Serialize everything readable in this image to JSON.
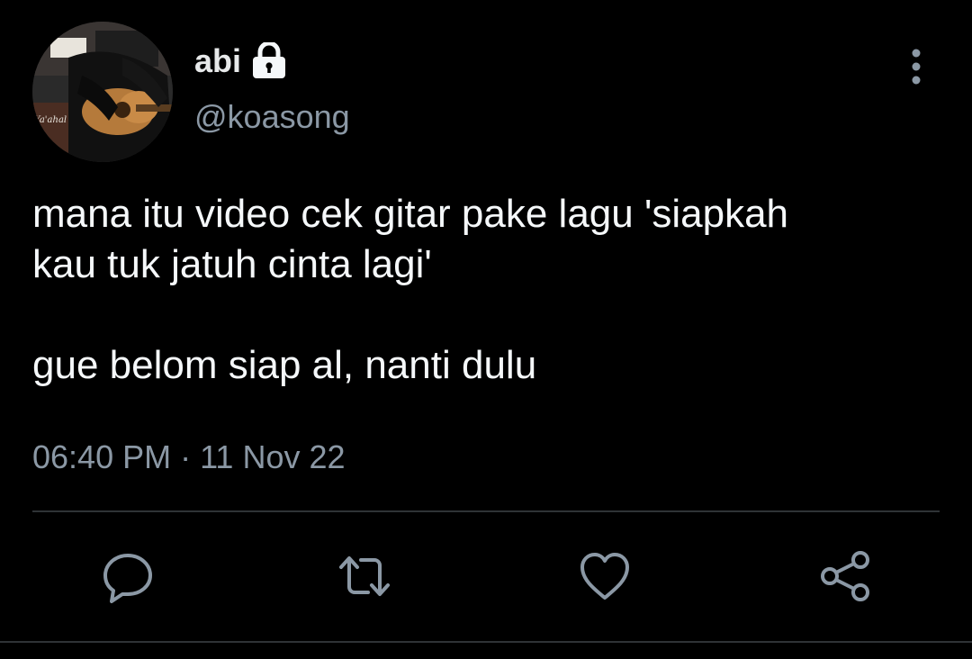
{
  "author": {
    "display_name": "abi",
    "handle": "@koasong",
    "avatar_icon": "avatar-guitar-photo",
    "protected_icon": "lock-icon"
  },
  "tweet": {
    "text_line1": "mana itu video cek gitar pake lagu 'siapkah",
    "text_line2": "kau tuk jatuh cinta lagi'",
    "text_line3": "gue belom siap al, nanti dulu",
    "timestamp": "06:40 PM · 11 Nov 22"
  },
  "actions": {
    "reply_icon": "reply-icon",
    "retweet_icon": "retweet-icon",
    "like_icon": "heart-icon",
    "share_icon": "share-icon",
    "more_icon": "more-vertical-icon"
  },
  "colors": {
    "background": "#000000",
    "text_primary": "#f5f8fa",
    "text_secondary": "#8b98a5",
    "icon": "#8b98a5",
    "divider": "#2f3336"
  }
}
